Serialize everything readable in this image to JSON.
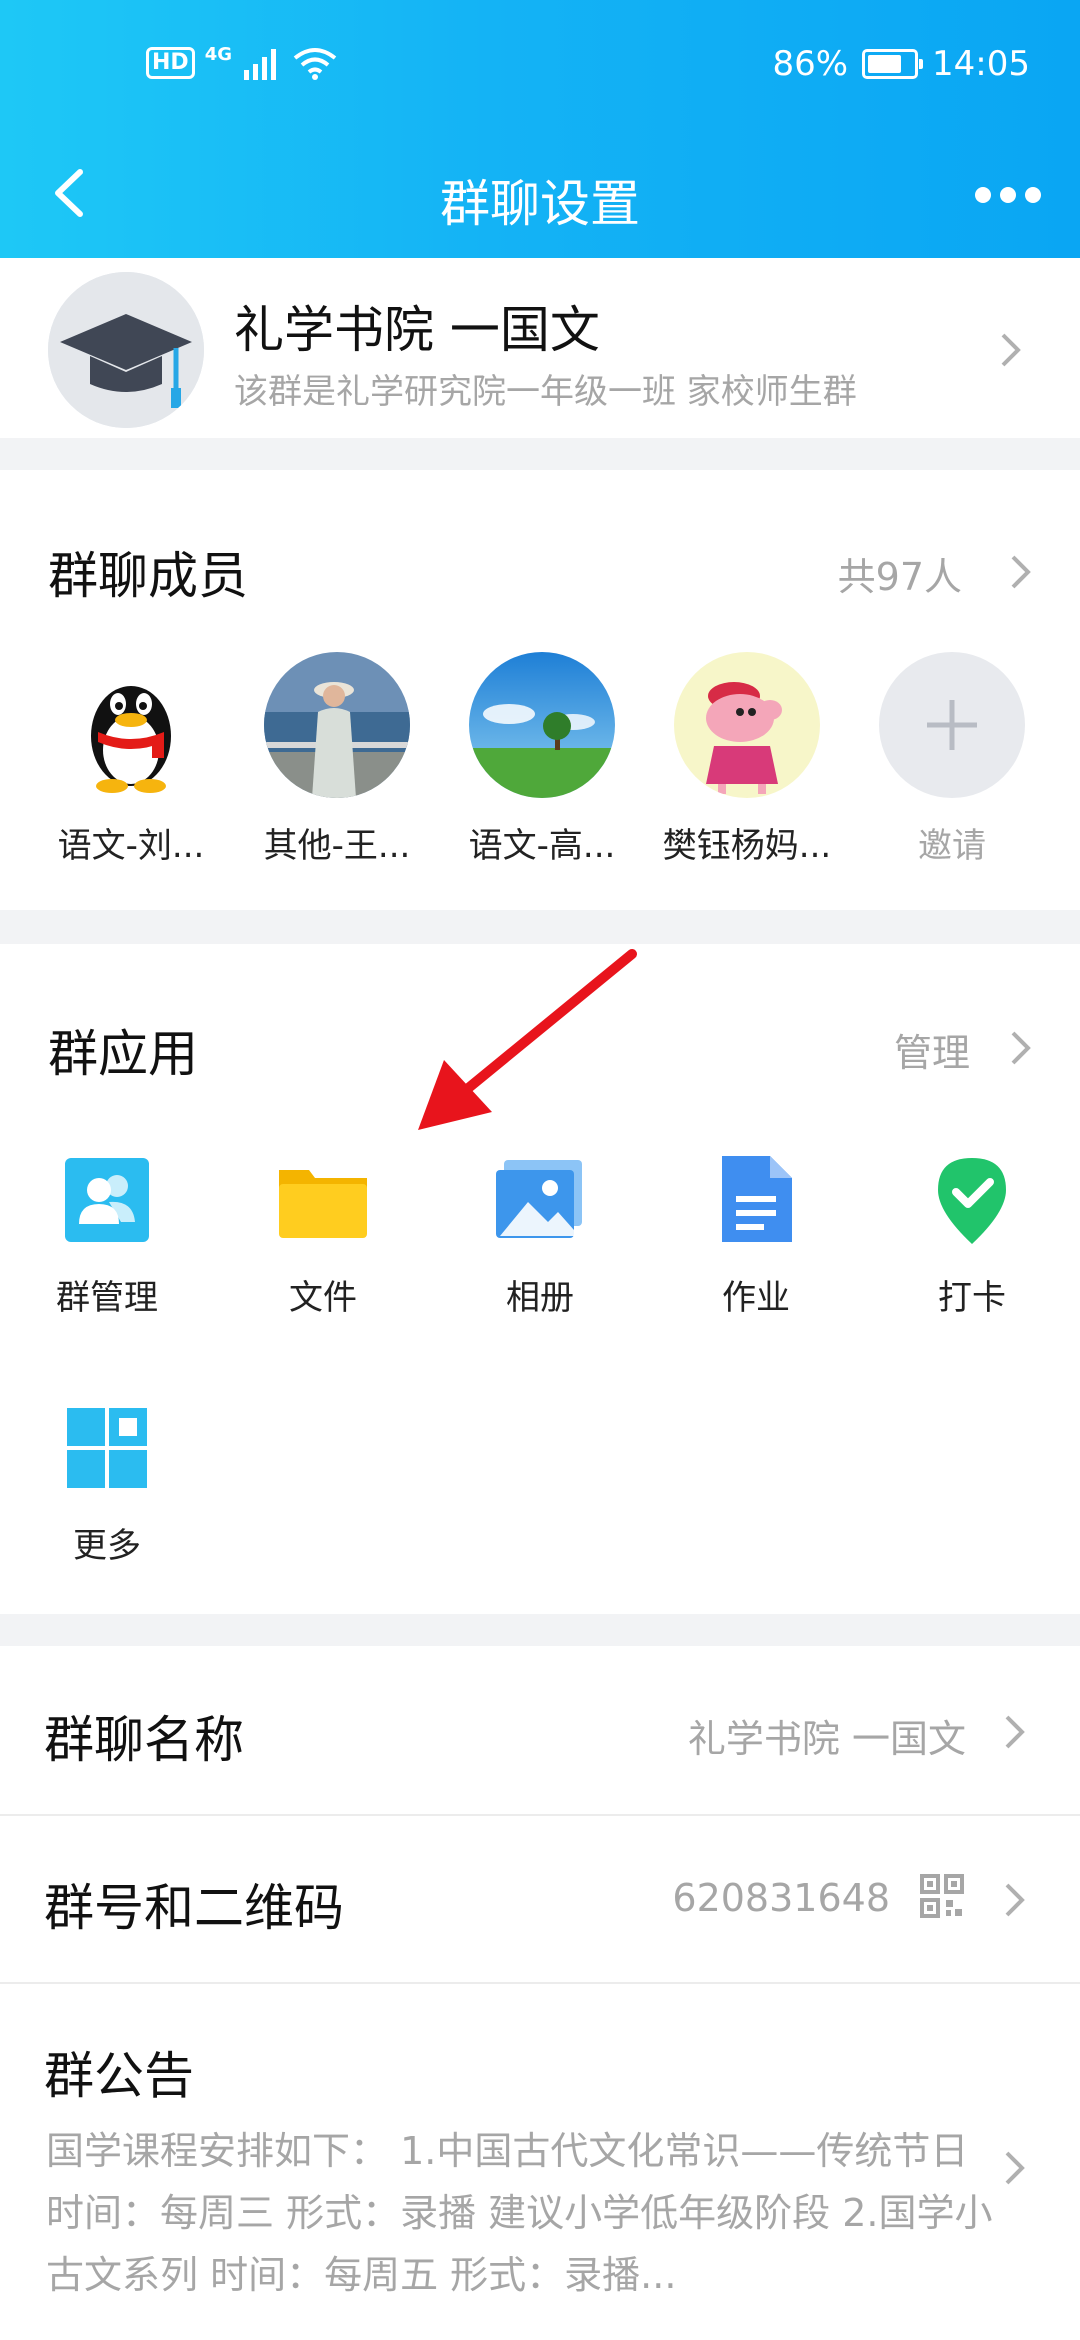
{
  "status": {
    "hd": "HD",
    "network": "4G",
    "battery_percent": "86%",
    "battery_level": 0.86,
    "time": "14:05"
  },
  "nav": {
    "title": "群聊设置"
  },
  "group": {
    "name": "礼学书院 一国文",
    "description": "该群是礼学研究院一年级一班 家校师生群"
  },
  "members": {
    "title": "群聊成员",
    "count": "共97人",
    "items": [
      {
        "name": "语文-刘..."
      },
      {
        "name": "其他-王..."
      },
      {
        "name": "语文-高..."
      },
      {
        "name": "樊钰杨妈..."
      }
    ],
    "invite_label": "邀请"
  },
  "apps": {
    "title": "群应用",
    "manage": "管理",
    "items": [
      {
        "label": "群管理",
        "icon": "group-manage-icon"
      },
      {
        "label": "文件",
        "icon": "folder-icon"
      },
      {
        "label": "相册",
        "icon": "album-icon"
      },
      {
        "label": "作业",
        "icon": "homework-icon"
      },
      {
        "label": "打卡",
        "icon": "check-in-icon"
      },
      {
        "label": "更多",
        "icon": "more-apps-icon"
      }
    ]
  },
  "settings": {
    "group_name_label": "群聊名称",
    "group_name_value": "礼学书院 一国文",
    "group_id_label": "群号和二维码",
    "group_id_value": "620831648",
    "notice_label": "群公告",
    "notice_text": "国学课程安排如下： 1.中国古代文化常识——传统节日  时间：每周三     形式：录播 建议小学低年级阶段  2.国学小古文系列 时间：每周五     形式：录播..."
  },
  "colors": {
    "header_start": "#1ec8f6",
    "header_end": "#0aa6f3",
    "annotation_arrow": "#e8141c"
  }
}
